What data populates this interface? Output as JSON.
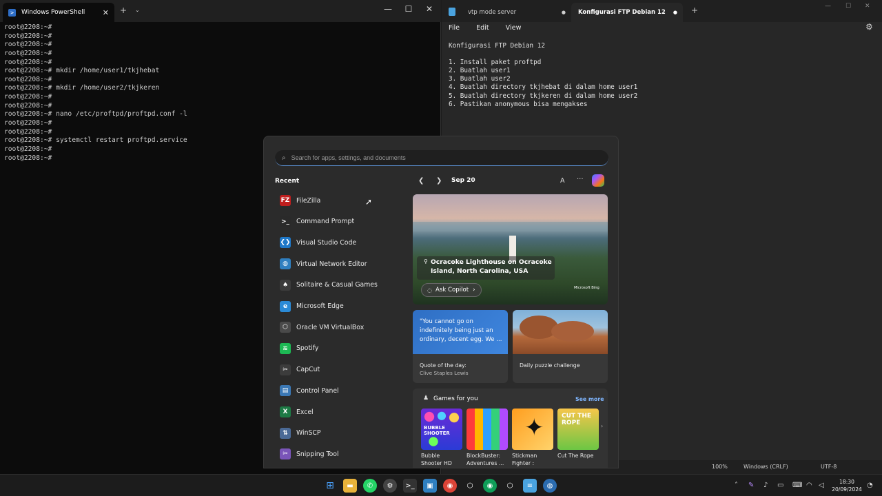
{
  "powershell": {
    "tab_title": "Windows PowerShell",
    "terminal_lines": [
      "root@2208:~#",
      "root@2208:~#",
      "root@2208:~#",
      "root@2208:~#",
      "root@2208:~#",
      "root@2208:~# mkdir /home/user1/tkjhebat",
      "root@2208:~#",
      "root@2208:~# mkdir /home/user2/tkjkeren",
      "root@2208:~#",
      "root@2208:~#",
      "root@2208:~# nano /etc/proftpd/proftpd.conf -l",
      "root@2208:~#",
      "root@2208:~#",
      "root@2208:~# systemctl restart proftpd.service",
      "root@2208:~#",
      "root@2208:~#"
    ]
  },
  "notepad": {
    "tabs": [
      {
        "label": "vtp mode server"
      },
      {
        "label": "Konfigurasi FTP Debian 12"
      }
    ],
    "menu": [
      "File",
      "Edit",
      "View"
    ],
    "text_lines": [
      "Konfigurasi FTP Debian 12",
      "",
      "1. Install paket proftpd",
      "2. Buatlah user1",
      "3. Buatlah user2",
      "4. Buatlah directory tkjhebat di dalam home user1",
      "5. Buatlah directory tkjkeren di dalam home user2",
      "6. Pastikan anonymous bisa mengakses"
    ],
    "status": {
      "zoom": "100%",
      "line_ending": "Windows (CRLF)",
      "encoding": "UTF-8"
    }
  },
  "start_panel": {
    "search_placeholder": "Search for apps, settings, and documents",
    "recent_label": "Recent",
    "recent_apps": [
      {
        "label": "FileZilla",
        "icon": "filezilla-icon",
        "color": "#bf1e1e",
        "glyph": "FZ"
      },
      {
        "label": "Command Prompt",
        "icon": "command-prompt-icon",
        "color": "#2a2a2a",
        "glyph": ">_"
      },
      {
        "label": "Visual Studio Code",
        "icon": "vscode-icon",
        "color": "#1f78c8",
        "glyph": "❮❯"
      },
      {
        "label": "Virtual Network Editor",
        "icon": "globe-icon",
        "color": "#2f7fc0",
        "glyph": "◍"
      },
      {
        "label": "Solitaire & Casual Games",
        "icon": "cards-icon",
        "color": "#3b3b3b",
        "glyph": "♠"
      },
      {
        "label": "Microsoft Edge",
        "icon": "edge-icon",
        "color": "#2b8ad6",
        "glyph": "e"
      },
      {
        "label": "Oracle VM VirtualBox",
        "icon": "virtualbox-icon",
        "color": "#4a4a4a",
        "glyph": "⬡"
      },
      {
        "label": "Spotify",
        "icon": "spotify-icon",
        "color": "#1db954",
        "glyph": "≋"
      },
      {
        "label": "CapCut",
        "icon": "capcut-icon",
        "color": "#3c3c3c",
        "glyph": "✂"
      },
      {
        "label": "Control Panel",
        "icon": "control-panel-icon",
        "color": "#3b78b5",
        "glyph": "▤"
      },
      {
        "label": "Excel",
        "icon": "excel-icon",
        "color": "#1d7a45",
        "glyph": "X"
      },
      {
        "label": "WinSCP",
        "icon": "winscp-icon",
        "color": "#4b6a96",
        "glyph": "⇅"
      },
      {
        "label": "Snipping Tool",
        "icon": "snipping-tool-icon",
        "color": "#7a55b8",
        "glyph": "✂"
      }
    ],
    "date": "Sep 20",
    "font_button": "A",
    "more_button": "···",
    "hero_caption": "Ocracoke Lighthouse on Ocracoke Island, North Carolina, USA",
    "hero_brand": "Microsoft Bing",
    "ask_copilot": "Ask Copilot",
    "quote_text": "\"You cannot go on indefinitely being just an ordinary, decent egg. We ...",
    "quote_label": "Quote of the day:",
    "quote_author": "Clive Staples Lewis",
    "puzzle_label": "Daily puzzle challenge",
    "games_title": "Games for you",
    "see_more": "See more",
    "games": [
      {
        "label": "Bubble Shooter HD",
        "thumb_text": "BUBBLE SHOOTER"
      },
      {
        "label": "BlockBuster: Adventures ...",
        "thumb_text": ""
      },
      {
        "label": "Stickman Fighter : Mega...",
        "thumb_text": ""
      },
      {
        "label": "Cut The Rope",
        "thumb_text": "CUT THE ROPE"
      }
    ]
  },
  "taskbar": {
    "time": "18:30",
    "date": "20/09/2024"
  }
}
